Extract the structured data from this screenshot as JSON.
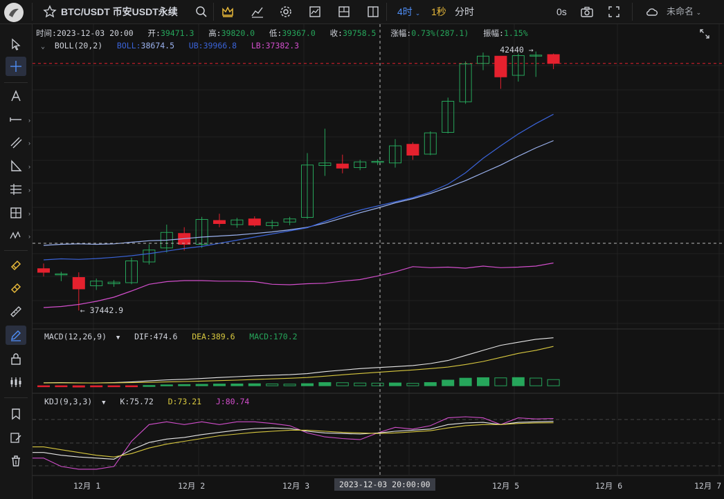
{
  "header": {
    "symbol": "BTC/USDT 币安USDT永续",
    "interval_selected": "4时",
    "interval_alt": "1秒",
    "interval_mode": "分时",
    "countdown": "0s",
    "layout_name": "未命名",
    "icons": [
      "star-icon",
      "search-icon",
      "crown-icon",
      "indicator-icon",
      "settings-icon",
      "chart-template-icon",
      "multi-chart-icon",
      "layout-icon",
      "camera-icon",
      "fullscreen-icon",
      "cloud-icon"
    ]
  },
  "ohlc": {
    "time_label": "时间:",
    "time": "2023-12-03 20:00",
    "open_label": "开:",
    "open": "39471.3",
    "high_label": "高:",
    "high": "39820.0",
    "low_label": "低:",
    "low": "39367.0",
    "close_label": "收:",
    "close": "39758.5",
    "change_label": "涨幅:",
    "change": "0.73%(287.1)",
    "amp_label": "振幅:",
    "amp": "1.15%"
  },
  "boll": {
    "name": "BOLL(20,2)",
    "boll_label": "BOLL:",
    "boll": "38674.5",
    "ub_label": "UB:",
    "ub": "39966.8",
    "lb_label": "LB:",
    "lb": "37382.3"
  },
  "macd": {
    "name": "MACD(12,26,9)",
    "dif_label": "DIF:",
    "dif": "474.6",
    "dea_label": "DEA:",
    "dea": "389.6",
    "macd_label": "MACD:",
    "macd": "170.2"
  },
  "kdj": {
    "name": "KDJ(9,3,3)",
    "k_label": "K:",
    "k": "75.72",
    "d_label": "D:",
    "d": "73.21",
    "j_label": "J:",
    "j": "80.74"
  },
  "annotations": {
    "max": "42440 →",
    "min": "← 37442.9"
  },
  "crosshair_time": "2023-12-03 20:00:00",
  "x_ticks": [
    "12月 1",
    "12月 2",
    "12月 3",
    "12月 5",
    "12月 6",
    "12月 7"
  ],
  "colors": {
    "up": "#26a65b",
    "down": "#e5212e",
    "boll_mid": "#3a63d8",
    "boll_ub": "#9cb3f0",
    "boll_lb": "#d24ecc",
    "dif": "#e8e8e8",
    "dea": "#d9c93f",
    "j": "#d24ecc",
    "accent": "#4f8ef7"
  },
  "chart_data": {
    "type": "candlestick",
    "candles": [
      {
        "o": 38250,
        "h": 38350,
        "l": 38100,
        "c": 38180
      },
      {
        "o": 38130,
        "h": 38190,
        "l": 38010,
        "c": 38150
      },
      {
        "o": 38080,
        "h": 38180,
        "l": 37443,
        "c": 37860
      },
      {
        "o": 37920,
        "h": 38060,
        "l": 37840,
        "c": 38010
      },
      {
        "o": 37960,
        "h": 38030,
        "l": 37900,
        "c": 37990
      },
      {
        "o": 37980,
        "h": 38460,
        "l": 37950,
        "c": 38400
      },
      {
        "o": 38380,
        "h": 38720,
        "l": 38330,
        "c": 38610
      },
      {
        "o": 38650,
        "h": 39100,
        "l": 38560,
        "c": 38950
      },
      {
        "o": 38930,
        "h": 39050,
        "l": 38600,
        "c": 38720
      },
      {
        "o": 38720,
        "h": 39250,
        "l": 38650,
        "c": 39200
      },
      {
        "o": 39180,
        "h": 39310,
        "l": 39050,
        "c": 39120
      },
      {
        "o": 39100,
        "h": 39230,
        "l": 39040,
        "c": 39190
      },
      {
        "o": 39210,
        "h": 39260,
        "l": 39060,
        "c": 39090
      },
      {
        "o": 39080,
        "h": 39190,
        "l": 39020,
        "c": 39140
      },
      {
        "o": 39150,
        "h": 39250,
        "l": 39090,
        "c": 39210
      },
      {
        "o": 39240,
        "h": 40480,
        "l": 39210,
        "c": 40250
      },
      {
        "o": 40240,
        "h": 40950,
        "l": 40040,
        "c": 40290
      },
      {
        "o": 40270,
        "h": 40450,
        "l": 40090,
        "c": 40190
      },
      {
        "o": 40200,
        "h": 40350,
        "l": 40150,
        "c": 40310
      },
      {
        "o": 40300,
        "h": 40360,
        "l": 40250,
        "c": 40320
      },
      {
        "o": 40290,
        "h": 40750,
        "l": 40200,
        "c": 40620
      },
      {
        "o": 40650,
        "h": 40690,
        "l": 40350,
        "c": 40440
      },
      {
        "o": 40460,
        "h": 40900,
        "l": 40440,
        "c": 40870
      },
      {
        "o": 40880,
        "h": 41550,
        "l": 40860,
        "c": 41480
      },
      {
        "o": 41470,
        "h": 42250,
        "l": 41430,
        "c": 42200
      },
      {
        "o": 42210,
        "h": 42420,
        "l": 42080,
        "c": 42350
      },
      {
        "o": 42350,
        "h": 42340,
        "l": 41720,
        "c": 41950
      },
      {
        "o": 41980,
        "h": 42400,
        "l": 41860,
        "c": 42360
      },
      {
        "o": 42360,
        "h": 42440,
        "l": 41950,
        "c": 42370
      },
      {
        "o": 42380,
        "h": 42400,
        "l": 42100,
        "c": 42210
      }
    ],
    "boll_mid": [
      38420,
      38440,
      38430,
      38445,
      38470,
      38500,
      38540,
      38590,
      38640,
      38680,
      38740,
      38800,
      38860,
      38920,
      38980,
      39040,
      39160,
      39280,
      39380,
      39460,
      39540,
      39620,
      39730,
      39880,
      40100,
      40380,
      40620,
      40850,
      41050,
      41230
    ],
    "boll_ub": [
      38700,
      38720,
      38730,
      38720,
      38730,
      38760,
      38790,
      38800,
      38830,
      38860,
      38880,
      38900,
      38930,
      38960,
      39000,
      39050,
      39130,
      39230,
      39330,
      39420,
      39520,
      39600,
      39700,
      39820,
      39950,
      40100,
      40250,
      40420,
      40580,
      40720
    ],
    "boll_lb": [
      37500,
      37520,
      37560,
      37620,
      37700,
      37820,
      37950,
      38000,
      38020,
      38020,
      38010,
      38010,
      38000,
      37950,
      37940,
      37960,
      37970,
      38010,
      38040,
      38110,
      38190,
      38290,
      38270,
      38280,
      38260,
      38300,
      38270,
      38280,
      38300,
      38360
    ],
    "macd_hist": [
      -8,
      -10,
      -13,
      -11,
      -9,
      -3,
      3,
      9,
      12,
      14,
      17,
      18,
      20,
      18,
      16,
      21,
      32,
      30,
      27,
      26,
      28,
      24,
      32,
      56,
      75,
      80,
      78,
      81,
      76,
      61
    ],
    "dif": [
      30,
      32,
      29,
      28,
      31,
      38,
      48,
      58,
      64,
      72,
      82,
      90,
      98,
      104,
      110,
      120,
      140,
      155,
      170,
      180,
      190,
      200,
      220,
      250,
      300,
      350,
      400,
      430,
      460,
      474.6
    ],
    "dea": [
      28,
      29,
      28,
      28,
      29,
      31,
      34,
      38,
      42,
      46,
      51,
      56,
      62,
      68,
      74,
      82,
      95,
      108,
      121,
      133,
      145,
      156,
      170,
      185,
      210,
      240,
      280,
      320,
      350,
      389.6
    ],
    "k": [
      20,
      15,
      12,
      10,
      8,
      25,
      38,
      44,
      47,
      52,
      56,
      60,
      63,
      64,
      63,
      58,
      55,
      54,
      53,
      55,
      58,
      60,
      62,
      70,
      73,
      74,
      70,
      74,
      75,
      75.72
    ],
    "d": [
      30,
      25,
      20,
      15,
      12,
      18,
      28,
      35,
      40,
      45,
      50,
      53,
      56,
      58,
      60,
      60,
      58,
      56,
      55,
      54,
      55,
      57,
      59,
      64,
      68,
      70,
      70,
      72,
      73,
      73.21
    ],
    "j": [
      10,
      -5,
      -10,
      -10,
      -5,
      40,
      70,
      75,
      70,
      75,
      70,
      75,
      75,
      72,
      68,
      55,
      48,
      45,
      43,
      55,
      65,
      62,
      68,
      82,
      84,
      82,
      70,
      82,
      80,
      80.74
    ]
  }
}
